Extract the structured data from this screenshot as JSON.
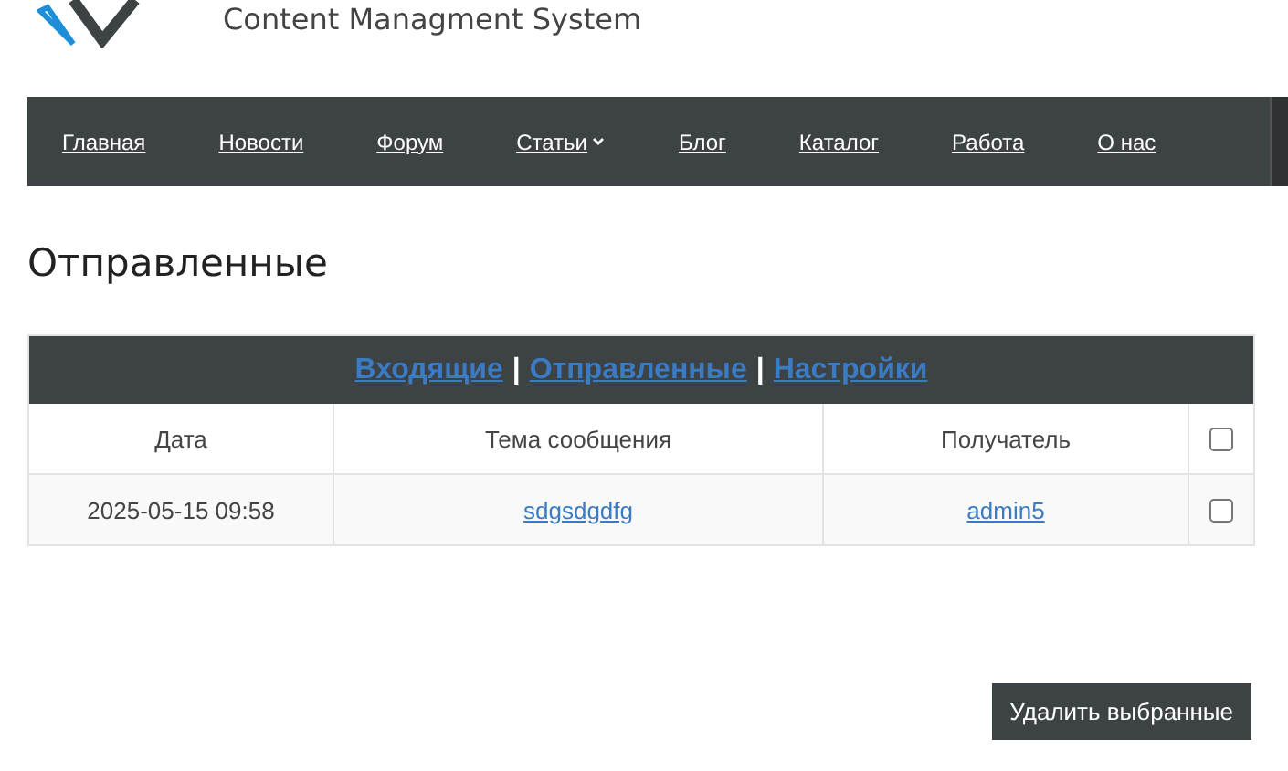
{
  "header": {
    "subtitle": "Content Managment System"
  },
  "nav": [
    {
      "label": "Главная",
      "kind": "link"
    },
    {
      "label": "Новости",
      "kind": "link"
    },
    {
      "label": "Форум",
      "kind": "link"
    },
    {
      "label": "Статьи",
      "kind": "dropdown"
    },
    {
      "label": "Блог",
      "kind": "link"
    },
    {
      "label": "Каталог",
      "kind": "link"
    },
    {
      "label": "Работа",
      "kind": "link"
    },
    {
      "label": "О нас",
      "kind": "link"
    }
  ],
  "page_title": "Отправленные",
  "folders": [
    {
      "label": "Входящие",
      "selected": false
    },
    {
      "label": "Отправленные",
      "selected": false
    },
    {
      "label": "Настройки",
      "selected": false
    }
  ],
  "separator": "|",
  "table": {
    "columns": [
      "Дата",
      "Тема сообщения",
      "Получатель"
    ],
    "header_checked": false,
    "rows": [
      {
        "date": "2025-05-15 09:58",
        "subject": "sdgsdgdfg",
        "recipient": "admin5",
        "checked": false
      }
    ]
  },
  "delete_button": "Удалить выбранные"
}
